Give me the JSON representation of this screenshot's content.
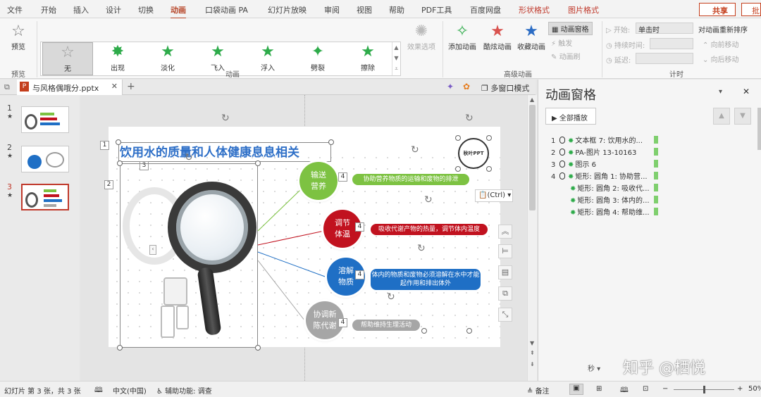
{
  "ribbon_tabs": [
    "文件",
    "开始",
    "插入",
    "设计",
    "切换",
    "动画",
    "口袋动画 PA",
    "幻灯片放映",
    "审阅",
    "视图",
    "帮助",
    "PDF工具",
    "百度网盘",
    "形状格式",
    "图片格式"
  ],
  "share_label": "共享",
  "comment_label": "批",
  "preview": {
    "label": "预览",
    "group": "预览"
  },
  "gallery": [
    {
      "label": "无",
      "icon": "star-outline-icon"
    },
    {
      "label": "出现",
      "icon": "star-burst-icon"
    },
    {
      "label": "淡化",
      "icon": "star-fade-icon"
    },
    {
      "label": "飞入",
      "icon": "star-fly-icon"
    },
    {
      "label": "浮入",
      "icon": "star-float-icon"
    },
    {
      "label": "劈裂",
      "icon": "star-split-icon"
    },
    {
      "label": "擦除",
      "icon": "star-wipe-icon"
    }
  ],
  "effect_options": "效果选项",
  "group_animation": "动画",
  "add_animation": "添加动画",
  "cool_animation": "酷炫动画",
  "collect_animation": "收藏动画",
  "anim_pane_btn": "动画窗格",
  "trigger": "触发",
  "anim_painter": "动画刷",
  "group_advanced": "高级动画",
  "start_label": "开始:",
  "start_value": "单击时",
  "duration_label": "持续时间:",
  "delay_label": "延迟:",
  "group_timing": "计时",
  "reorder_title": "对动画重新排序",
  "move_earlier": "向前移动",
  "move_later": "向后移动",
  "doc_tab": "与风格偶哦分.pptx",
  "multi_window": "多窗口模式",
  "thumbnails": [
    {
      "num": "1"
    },
    {
      "num": "2"
    },
    {
      "num": "3"
    }
  ],
  "slide": {
    "title": "饮用水的质量和人体健康息息相关",
    "logo_text": "秋叶PPT",
    "paste_ctrl": "(Ctrl)",
    "tags": [
      "1",
      "2",
      "3"
    ],
    "items": [
      {
        "circle": "输送\n营养",
        "bar": "协助营养物质的运输和废物的排泄",
        "color": "#7dc242",
        "tag": "4"
      },
      {
        "circle": "调节\n体温",
        "bar": "吸收代谢产物的热量，调节体内温度",
        "color": "#c1121f",
        "tag": "4"
      },
      {
        "circle": "溶解\n物质",
        "bar": "体内的物质和废物必须溶解在水中才能起作用和排出体外",
        "color": "#1f6fc5",
        "tag": "4"
      },
      {
        "circle": "协调新\n陈代谢",
        "bar": "帮助维持生理活动",
        "color": "#a6a6a6",
        "tag": "4"
      }
    ]
  },
  "pane": {
    "title": "动画窗格",
    "play_all": "全部播放",
    "items": [
      {
        "num": "1",
        "mouse": true,
        "label": "文本框 7: 饮用水的..."
      },
      {
        "num": "2",
        "mouse": true,
        "label": "PA-图片 13-10163"
      },
      {
        "num": "3",
        "mouse": true,
        "label": "图示 6"
      },
      {
        "num": "4",
        "mouse": true,
        "label": "矩形: 圆角 1: 协助营..."
      },
      {
        "num": "",
        "mouse": false,
        "label": "矩形: 圆角 2: 吸收代..."
      },
      {
        "num": "",
        "mouse": false,
        "label": "矩形: 圆角 3: 体内的..."
      },
      {
        "num": "",
        "mouse": false,
        "label": "矩形: 圆角 4: 帮助维..."
      }
    ],
    "seconds": "秒",
    "watermark": "知乎 @栖悦"
  },
  "status": {
    "slide_info": "幻灯片 第 3 张，共 3 张",
    "language": "中文(中国)",
    "accessibility": "辅助功能: 调查",
    "notes": "备注",
    "zoom": "50%"
  },
  "colors": {
    "accent": "#b7472a",
    "green": "#2eab4a",
    "title_blue": "#2e6fc7"
  }
}
